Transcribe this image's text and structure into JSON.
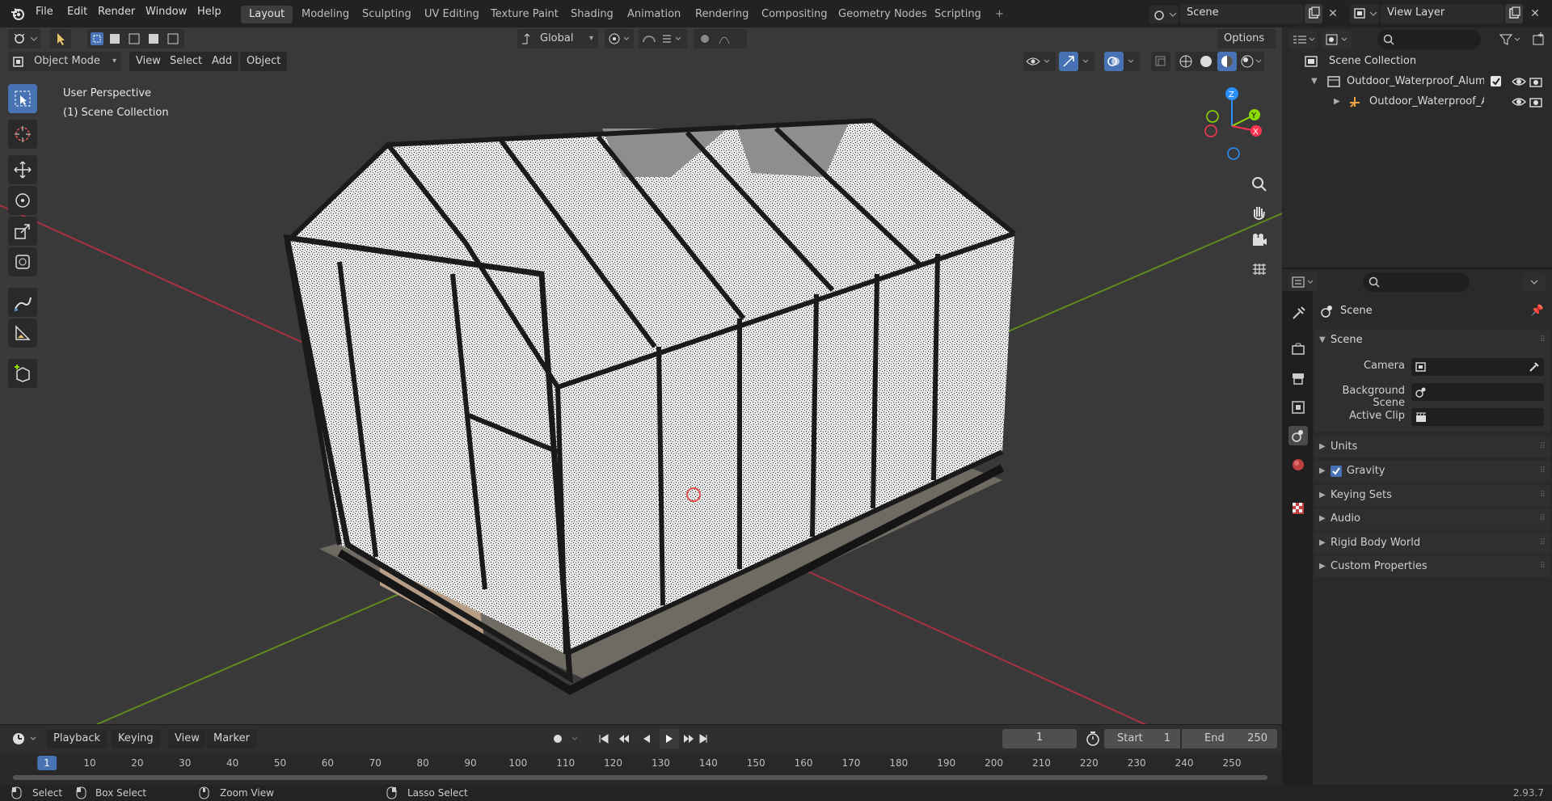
{
  "topbar": {
    "menus": [
      "File",
      "Edit",
      "Render",
      "Window",
      "Help"
    ],
    "workspaces": [
      "Layout",
      "Modeling",
      "Sculpting",
      "UV Editing",
      "Texture Paint",
      "Shading",
      "Animation",
      "Rendering",
      "Compositing",
      "Geometry Nodes",
      "Scripting"
    ],
    "add_workspace": "+",
    "scene_name": "Scene",
    "view_layer_name": "View Layer"
  },
  "viewport_header": {
    "mode": "Object Mode",
    "menus": [
      "View",
      "Select",
      "Add",
      "Object"
    ],
    "orientation": "Global",
    "options": "Options"
  },
  "viewport": {
    "perspective": "User Perspective",
    "collection": "(1) Scene Collection",
    "gizmo_axes": [
      "Z",
      "Y",
      "X"
    ]
  },
  "outliner": {
    "root": "Scene Collection",
    "items": [
      {
        "label": "Outdoor_Waterproof_Aluminu",
        "type": "collection",
        "checked": true
      },
      {
        "label": "Outdoor_Waterproof_Alu",
        "type": "object"
      }
    ]
  },
  "properties": {
    "context": "Scene",
    "section": "Scene",
    "fields": [
      {
        "label": "Camera",
        "value": ""
      },
      {
        "label": "Background Scene",
        "value": ""
      },
      {
        "label": "Active Clip",
        "value": ""
      }
    ],
    "subpanels": [
      "Units",
      "Gravity",
      "Keying Sets",
      "Audio",
      "Rigid Body World",
      "Custom Properties"
    ],
    "gravity_enabled": true
  },
  "timeline": {
    "menus": [
      "Playback",
      "Keying",
      "View",
      "Marker"
    ],
    "current_frame": "1",
    "start_label": "Start",
    "start": "1",
    "end_label": "End",
    "end": "250",
    "ruler": [
      "1",
      "10",
      "20",
      "30",
      "40",
      "50",
      "60",
      "70",
      "80",
      "90",
      "100",
      "110",
      "120",
      "130",
      "140",
      "150",
      "160",
      "170",
      "180",
      "190",
      "200",
      "210",
      "220",
      "230",
      "240",
      "250"
    ]
  },
  "status": {
    "select": "Select",
    "box_select": "Box Select",
    "zoom_view": "Zoom View",
    "lasso_select": "Lasso Select",
    "version": "2.93.7"
  },
  "colors": {
    "accent": "#4772b3",
    "x_axis": "#ff3352",
    "y_axis": "#8bdc00",
    "z_axis": "#2890ff"
  }
}
